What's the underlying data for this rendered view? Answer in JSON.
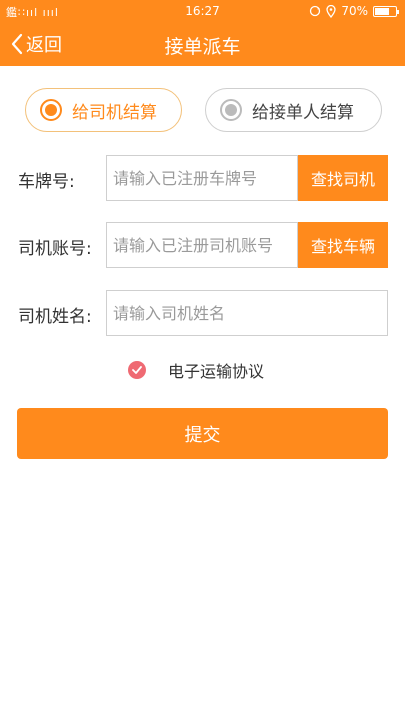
{
  "status_bar": {
    "signal_text": "鑑∷ııl ıııl",
    "time": "16:27",
    "battery_percent": "70%",
    "battery_level": 0.7
  },
  "nav": {
    "back_label": "返回",
    "title": "接单派车"
  },
  "settlement": {
    "options": [
      {
        "label": "给司机结算",
        "selected": true
      },
      {
        "label": "给接单人结算",
        "selected": false
      }
    ]
  },
  "form": {
    "plate": {
      "label": "车牌号:",
      "placeholder": "请输入已注册车牌号",
      "button": "查找司机"
    },
    "driver_account": {
      "label": "司机账号:",
      "placeholder": "请输入已注册司机账号",
      "button": "查找车辆"
    },
    "driver_name": {
      "label": "司机姓名:",
      "placeholder": "请输入司机姓名"
    }
  },
  "agreement": {
    "label": "电子运输协议",
    "checked": true
  },
  "submit_label": "提交",
  "colors": {
    "primary": "#ff8a1c",
    "check": "#ef6a73"
  }
}
